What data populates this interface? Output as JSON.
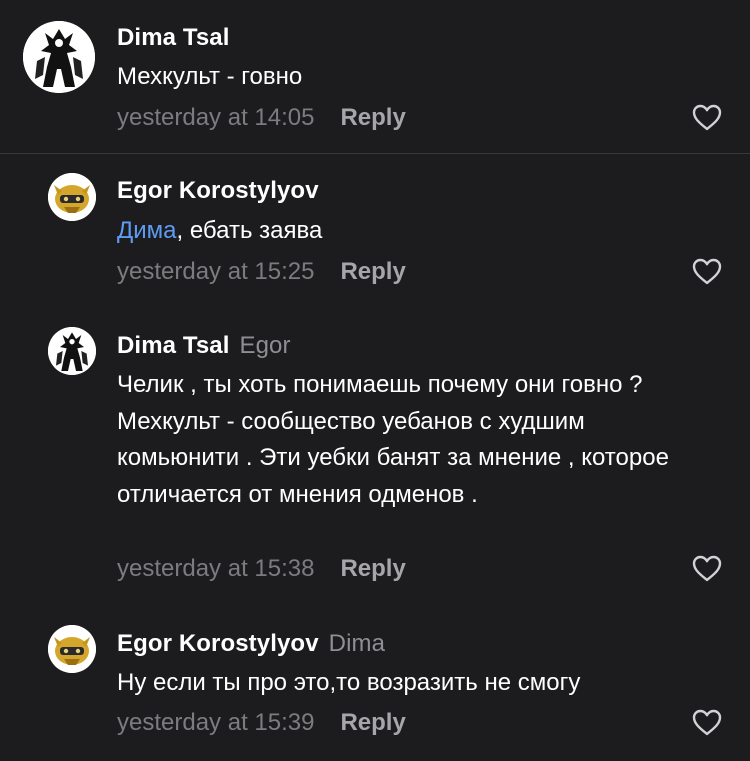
{
  "comments": [
    {
      "author": "Dima Tsal",
      "reply_to": "",
      "mention": "",
      "text": "Мехкульт - говно",
      "time": "yesterday at 14:05",
      "reply_label": "Reply",
      "avatar_icon": "warrior-avatar",
      "like_icon": "heart-outline-icon"
    },
    {
      "author": "Egor Korostylyov",
      "reply_to": "",
      "mention": "Дима",
      "text": ", ебать заява",
      "time": "yesterday at 15:25",
      "reply_label": "Reply",
      "avatar_icon": "golden-mask-avatar",
      "like_icon": "heart-outline-icon"
    },
    {
      "author": "Dima Tsal",
      "reply_to": "Egor",
      "mention": "",
      "text": "Челик , ты хоть понимаешь почему они говно ? Мехкульт - сообщество уебанов с худшим комьюнити . Эти уебки банят за мнение , которое отличается от мнения одменов .",
      "time": "yesterday at 15:38",
      "reply_label": "Reply",
      "avatar_icon": "warrior-avatar",
      "like_icon": "heart-outline-icon"
    },
    {
      "author": "Egor Korostylyov",
      "reply_to": "Dima",
      "mention": "",
      "text": "Ну если ты про это,то возразить не смогу",
      "time": "yesterday at 15:39",
      "reply_label": "Reply",
      "avatar_icon": "golden-mask-avatar",
      "like_icon": "heart-outline-icon"
    }
  ],
  "colors": {
    "background": "#1c1c1e",
    "text": "#ffffff",
    "meta": "#7c7c80",
    "mention": "#5e9cf3",
    "divider": "#38383a"
  }
}
